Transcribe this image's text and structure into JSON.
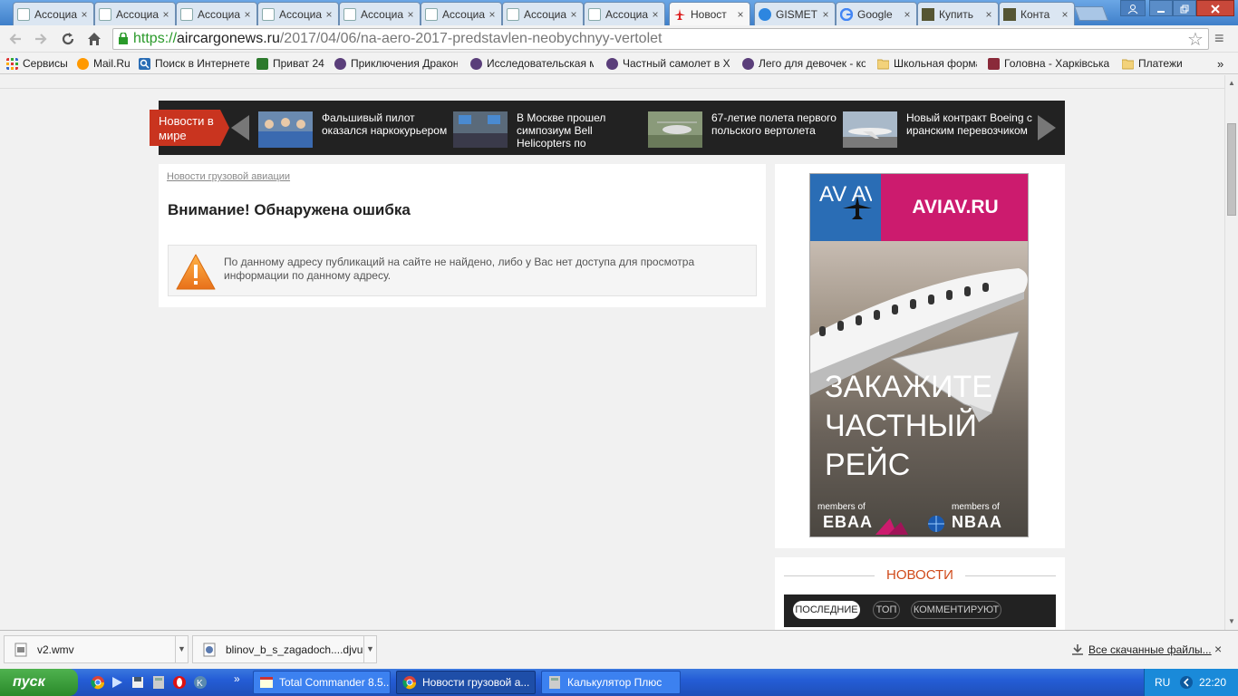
{
  "browser": {
    "tabs": [
      {
        "label": "Ассоциа",
        "icon": "aircargonews-favicon-icon",
        "active": false
      },
      {
        "label": "Ассоциа",
        "icon": "aircargonews-favicon-icon",
        "active": false
      },
      {
        "label": "Ассоциа",
        "icon": "aircargonews-favicon-icon",
        "active": false
      },
      {
        "label": "Ассоциа",
        "icon": "aircargonews-favicon-icon",
        "active": false
      },
      {
        "label": "Ассоциа",
        "icon": "aircargonews-favicon-icon",
        "active": false
      },
      {
        "label": "Ассоциа",
        "icon": "aircargonews-favicon-icon",
        "active": false
      },
      {
        "label": "Ассоциа",
        "icon": "aircargonews-favicon-icon",
        "active": false
      },
      {
        "label": "Ассоциа",
        "icon": "aircargonews-favicon-icon",
        "active": false
      },
      {
        "label": "Новост",
        "icon": "airplane-favicon-icon",
        "active": true
      },
      {
        "label": "GISMET",
        "icon": "gismeteo-favicon-icon",
        "active": false
      },
      {
        "label": "Google",
        "icon": "google-favicon-icon",
        "active": false
      },
      {
        "label": "Купить",
        "icon": "shop-favicon-icon",
        "active": false
      },
      {
        "label": "Конта",
        "icon": "shop-favicon-icon",
        "active": false
      }
    ],
    "tab_close_glyph": "×",
    "url": {
      "scheme": "https://",
      "domain": "aircargonews.ru",
      "path": "/2017/04/06/na-aero-2017-predstavlen-neobychnyy-vertolet"
    },
    "bookmarks": [
      {
        "label": "Сервисы",
        "icon": "apps-grid-icon"
      },
      {
        "label": "Mail.Ru",
        "icon": "mailru-icon"
      },
      {
        "label": "Поиск в Интернете",
        "icon": "search-icon"
      },
      {
        "label": "Приват 24",
        "icon": "privat24-icon"
      },
      {
        "label": "Приключения Дракона",
        "icon": "bookmark-icon"
      },
      {
        "label": "Исследовательская ма",
        "icon": "bookmark-icon"
      },
      {
        "label": "Частный самолет в Хар",
        "icon": "bookmark-icon"
      },
      {
        "label": "Лего для девочек - кон",
        "icon": "bookmark-icon"
      },
      {
        "label": "Школьная форма",
        "icon": "folder-icon"
      },
      {
        "label": "Головна - Харківська г",
        "icon": "bookmark-icon"
      },
      {
        "label": "Платежи",
        "icon": "folder-icon"
      }
    ],
    "bookmarks_more": "»"
  },
  "ticker": {
    "label": "Новости в мире",
    "items": [
      {
        "title": "Фальшивый пилот оказался наркокурьером"
      },
      {
        "title": "В Москве прошел симпозиум Bell Helicopters по"
      },
      {
        "title": "67-летие полета первого польского вертолета"
      },
      {
        "title": "Новый контракт Boeing с иранским перевозчиком"
      }
    ]
  },
  "main": {
    "breadcrumb": "Новости грузовой авиации",
    "error_title": "Внимание! Обнаружена ошибка",
    "error_message": "По данному адресу публикаций на сайте не найдено, либо у Вас нет доступа для просмотра информации по данному адресу."
  },
  "ad": {
    "logo_text": "AV AV",
    "brand": "AVIAV.RU",
    "slogan": [
      "ЗАКАЖИТЕ",
      "ЧАСТНЫЙ",
      "РЕЙС"
    ],
    "members_left": "members of",
    "org_left": "EBAA",
    "members_right": "members of",
    "org_right": "NBAA"
  },
  "news_widget": {
    "title": "НОВОСТИ",
    "tabs": [
      "ПОСЛЕДНИЕ",
      "ТОП",
      "КОММЕНТИРУЮТ"
    ],
    "selected_tab": "ПОСЛЕДНИЕ"
  },
  "downloads": {
    "items": [
      {
        "name": "v2.wmv"
      },
      {
        "name": "blinov_b_s_zagadoch....djvu"
      }
    ],
    "show_all": "Все скачанные файлы...",
    "close": "×"
  },
  "taskbar": {
    "start": "пуск",
    "tasks": [
      {
        "label": "Total Commander 8.5...",
        "icon": "total-commander-icon"
      },
      {
        "label": "Новости грузовой а...",
        "icon": "chrome-icon"
      },
      {
        "label": "Калькулятор Плюс",
        "icon": "calculator-icon"
      }
    ],
    "quicklaunch_more": "»",
    "lang": "RU",
    "time": "22:20"
  }
}
